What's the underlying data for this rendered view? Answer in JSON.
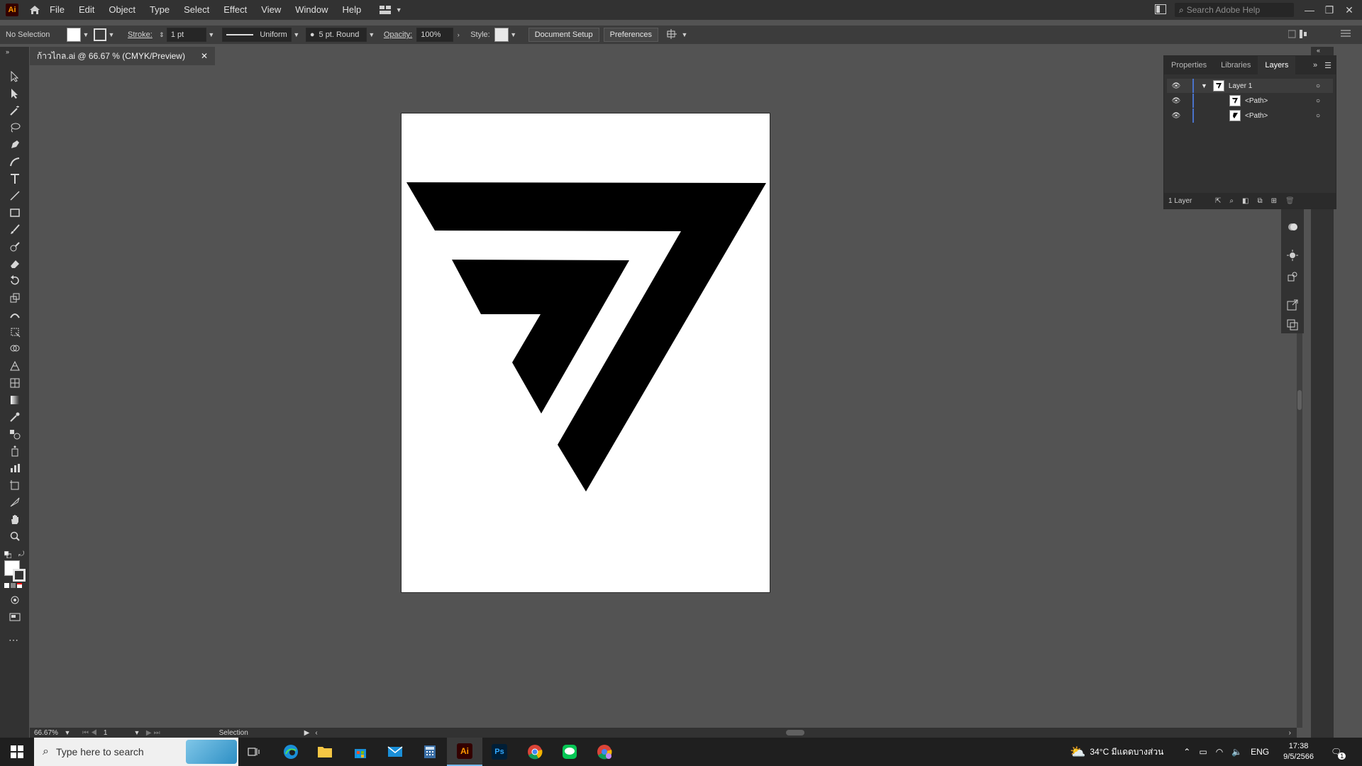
{
  "app": {
    "logo": "Ai",
    "menu": [
      "File",
      "Edit",
      "Object",
      "Type",
      "Select",
      "Effect",
      "View",
      "Window",
      "Help"
    ],
    "help_search_placeholder": "Search Adobe Help"
  },
  "control_bar": {
    "selection": "No Selection",
    "stroke_label": "Stroke:",
    "stroke_value": "1 pt",
    "profile": "Uniform",
    "brush": "5 pt. Round",
    "opacity_label": "Opacity:",
    "opacity_value": "100%",
    "style_label": "Style:",
    "document_setup": "Document Setup",
    "preferences": "Preferences"
  },
  "document": {
    "tab_title": "ก้าวไกล.ai @ 66.67 % (CMYK/Preview)"
  },
  "layers_panel": {
    "tabs": [
      "Properties",
      "Libraries",
      "Layers"
    ],
    "active_tab": "Layers",
    "rows": [
      {
        "name": "Layer 1"
      },
      {
        "name": "<Path>"
      },
      {
        "name": "<Path>"
      }
    ],
    "footer": "1 Layer"
  },
  "status_bar": {
    "zoom": "66.67%",
    "artboard_number": "1",
    "tool_name": "Selection"
  },
  "taskbar": {
    "search_placeholder": "Type here to search",
    "weather": "34°C มีแดดบางส่วน",
    "language": "ENG",
    "time": "17:38",
    "date": "9/5/2566",
    "notification_count": "1"
  },
  "colors": {
    "accent_layer": "#4a72c9",
    "brand_ai": "#ff9a00",
    "canvas_bg": "#535353"
  }
}
